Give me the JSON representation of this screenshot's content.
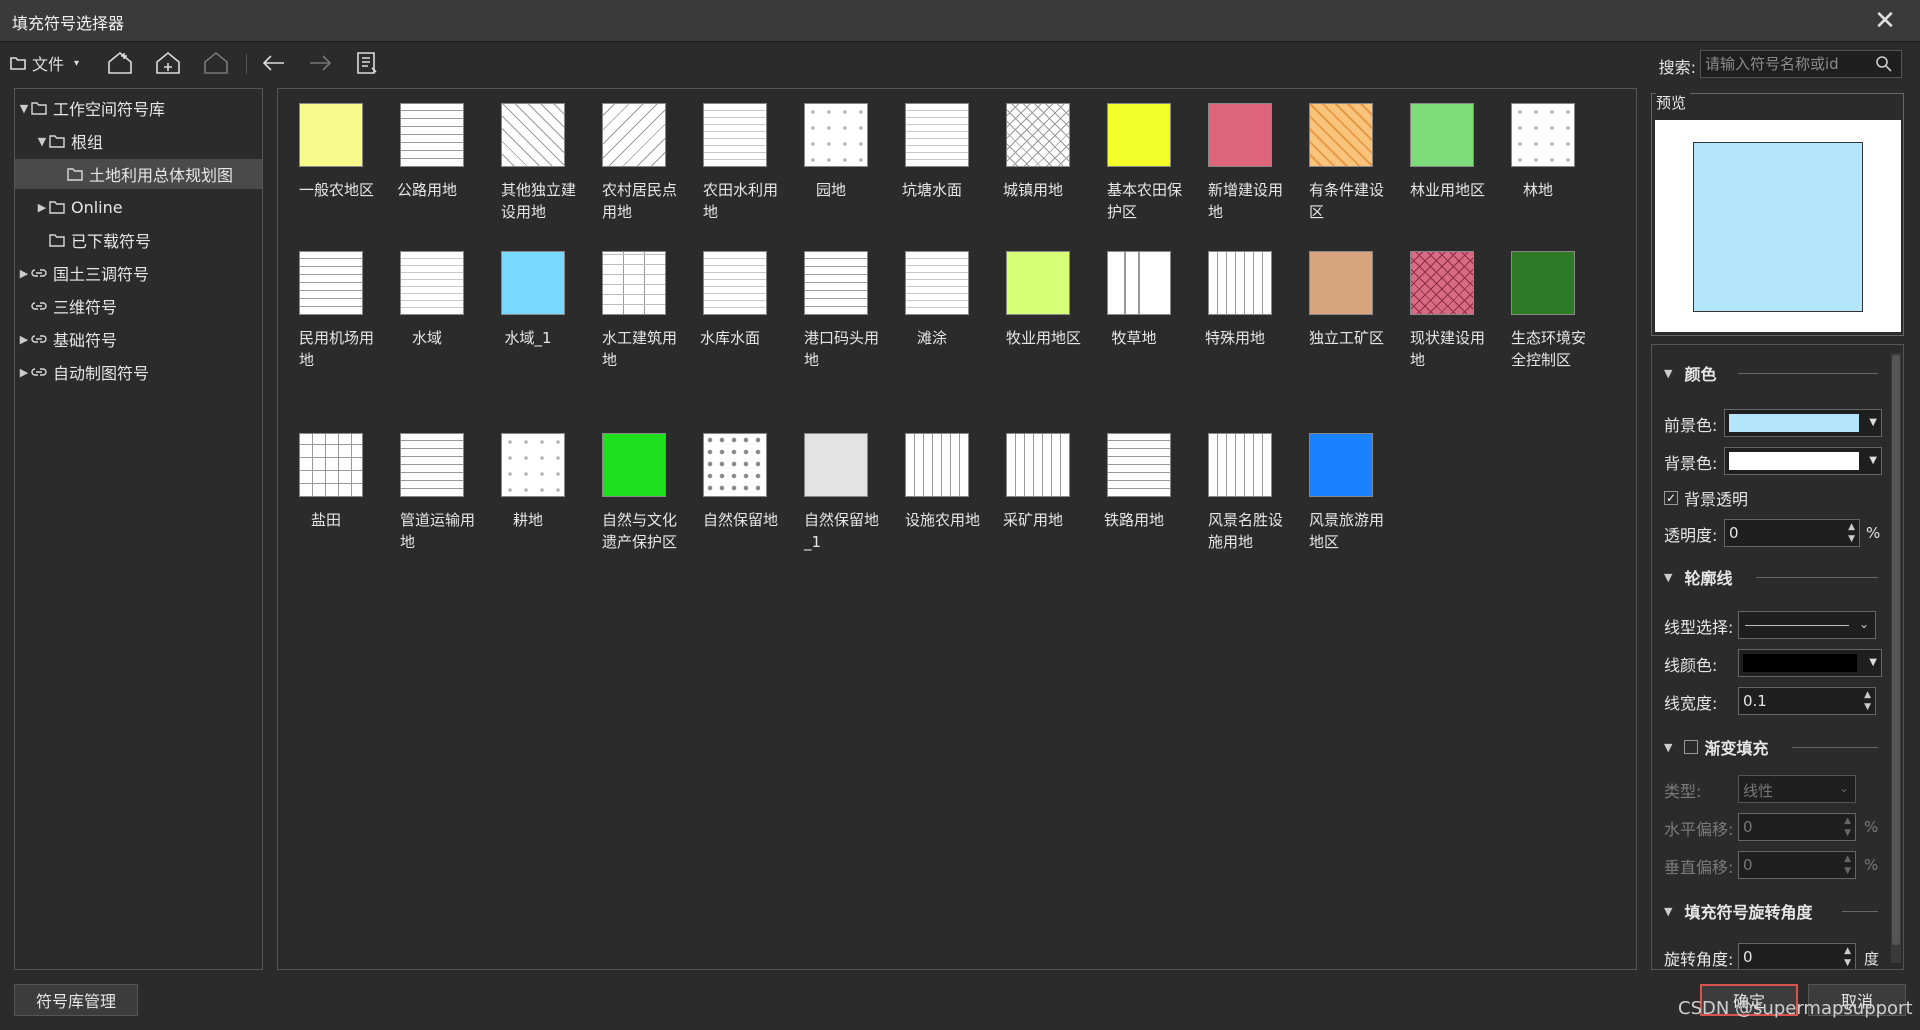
{
  "window": {
    "title": "填充符号选择器",
    "close_glyph": "✕"
  },
  "toolbar": {
    "file_label": "文件",
    "icons": [
      "folder-icon",
      "new-house-icon",
      "add-house-icon",
      "home-icon",
      "back-arrow-icon",
      "forward-arrow-icon",
      "properties-icon"
    ],
    "search_label": "搜索:",
    "search_placeholder": "请输入符号名称或id"
  },
  "tree": [
    {
      "label": "工作空间符号库",
      "arrow": "▼",
      "icon": "folder-icon"
    },
    {
      "label": "根组",
      "arrow": "▼",
      "icon": "folder-icon"
    },
    {
      "label": "土地利用总体规划图",
      "arrow": "",
      "icon": "folder-icon",
      "selected": true
    },
    {
      "label": "Online",
      "arrow": "▶",
      "icon": "folder-icon"
    },
    {
      "label": "已下载符号",
      "arrow": "",
      "icon": "folder-icon"
    },
    {
      "label": "国土三调符号",
      "arrow": "▶",
      "icon": "link-icon"
    },
    {
      "label": "三维符号",
      "arrow": "",
      "icon": "link-icon"
    },
    {
      "label": "基础符号",
      "arrow": "▶",
      "icon": "link-icon"
    },
    {
      "label": "自动制图符号",
      "arrow": "▶",
      "icon": "link-icon"
    }
  ],
  "symbols": [
    {
      "label": "一般农地区",
      "pattern": "solid",
      "color": "#f5fa8a"
    },
    {
      "label": "公路用地",
      "pattern": "hlines",
      "color": "#ffffff"
    },
    {
      "label": "其他独立建设用地",
      "pattern": "diag",
      "color": "#ffffff"
    },
    {
      "label": "农村居民点用地",
      "pattern": "diag2",
      "color": "#ffffff"
    },
    {
      "label": "农田水利用地",
      "pattern": "dashes",
      "color": "#ffffff"
    },
    {
      "label": "园地",
      "pattern": "dots",
      "color": "#ffffff"
    },
    {
      "label": "坑塘水面",
      "pattern": "dashes",
      "color": "#ffffff"
    },
    {
      "label": "城镇用地",
      "pattern": "cross",
      "color": "#ffffff"
    },
    {
      "label": "基本农田保护区",
      "pattern": "solid",
      "color": "#f4ff29"
    },
    {
      "label": "新增建设用地",
      "pattern": "solid",
      "color": "#df667a"
    },
    {
      "label": "有条件建设区",
      "pattern": "diagcolor",
      "color": "#fbc47c"
    },
    {
      "label": "林业用地区",
      "pattern": "solid",
      "color": "#7ddb7a"
    },
    {
      "label": "林地",
      "pattern": "dots",
      "color": "#ffffff"
    },
    {
      "label": "民用机场用地",
      "pattern": "hlines",
      "color": "#ffffff"
    },
    {
      "label": "水域",
      "pattern": "dashes",
      "color": "#ffffff"
    },
    {
      "label": "水域_1",
      "pattern": "solid",
      "color": "#78d8ff"
    },
    {
      "label": "水工建筑用地",
      "pattern": "grid2",
      "color": "#ffffff"
    },
    {
      "label": "水库水面",
      "pattern": "dashes",
      "color": "#ffffff"
    },
    {
      "label": "港口码头用地",
      "pattern": "hlines",
      "color": "#ffffff"
    },
    {
      "label": "滩涂",
      "pattern": "dashes",
      "color": "#ffffff"
    },
    {
      "label": "牧业用地区",
      "pattern": "solid",
      "color": "#d8ff78"
    },
    {
      "label": "牧草地",
      "pattern": "bars",
      "color": "#ffffff"
    },
    {
      "label": "特殊用地",
      "pattern": "vlines",
      "color": "#ffffff"
    },
    {
      "label": "独立工矿区",
      "pattern": "solid",
      "color": "#d8a47e"
    },
    {
      "label": "现状建设用地",
      "pattern": "crosscolor",
      "color": "#d96a84"
    },
    {
      "label": "生态环境安全控制区",
      "pattern": "solid",
      "color": "#2e7a26"
    },
    {
      "label": "盐田",
      "pattern": "grid",
      "color": "#ffffff"
    },
    {
      "label": "管道运输用地",
      "pattern": "hlines",
      "color": "#ffffff"
    },
    {
      "label": "耕地",
      "pattern": "dots",
      "color": "#ffffff"
    },
    {
      "label": "自然与文化遗产保护区",
      "pattern": "solid",
      "color": "#1ee01e"
    },
    {
      "label": "自然保留地",
      "pattern": "dotgrid",
      "color": "#ffffff"
    },
    {
      "label": "自然保留地_1",
      "pattern": "solid",
      "color": "#e3e3e3"
    },
    {
      "label": "设施农用地",
      "pattern": "vlines",
      "color": "#ffffff"
    },
    {
      "label": "采矿用地",
      "pattern": "vlines",
      "color": "#ffffff"
    },
    {
      "label": "铁路用地",
      "pattern": "hlines",
      "color": "#ffffff"
    },
    {
      "label": "风景名胜设施用地",
      "pattern": "vlines",
      "color": "#ffffff"
    },
    {
      "label": "风景旅游用地区",
      "pattern": "solid",
      "color": "#1a82ff"
    }
  ],
  "preview": {
    "title": "预览",
    "fill_color": "#b3e5fb"
  },
  "props": {
    "color_section": "颜色",
    "fg_label": "前景色:",
    "fg_color": "#b3e5fb",
    "bg_label": "背景色:",
    "bg_color": "#ffffff",
    "bg_transparent_label": "背景透明",
    "bg_transparent_checked": "✓",
    "transparency_label": "透明度:",
    "transparency_value": "0",
    "percent": "%",
    "outline_section": "轮廓线",
    "line_type_label": "线型选择:",
    "line_color_label": "线颜色:",
    "line_color": "#000000",
    "line_width_label": "线宽度:",
    "line_width_value": "0.1",
    "gradient_section": "渐变填充",
    "type_label": "类型:",
    "type_value": "线性",
    "h_offset_label": "水平偏移:",
    "h_offset_value": "0",
    "v_offset_label": "垂直偏移:",
    "v_offset_value": "0",
    "rotation_section": "填充符号旋转角度",
    "rotation_label": "旋转角度:",
    "rotation_value": "0",
    "degree_unit": "度"
  },
  "buttons": {
    "manage": "符号库管理",
    "ok": "确定",
    "cancel": "取消"
  },
  "watermark": "CSDN @supermapsupport"
}
